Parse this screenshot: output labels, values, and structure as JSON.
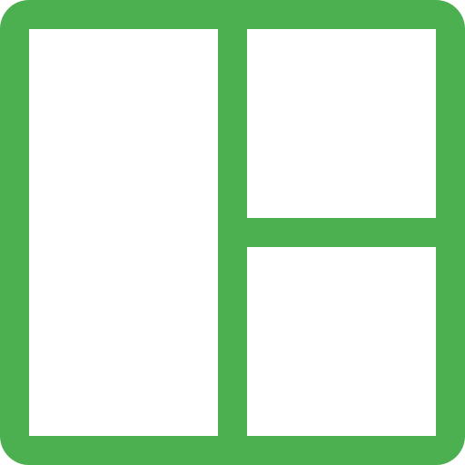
{
  "icon": {
    "name": "layout-icon",
    "color": "#4caf50",
    "background": "#ffffff"
  }
}
